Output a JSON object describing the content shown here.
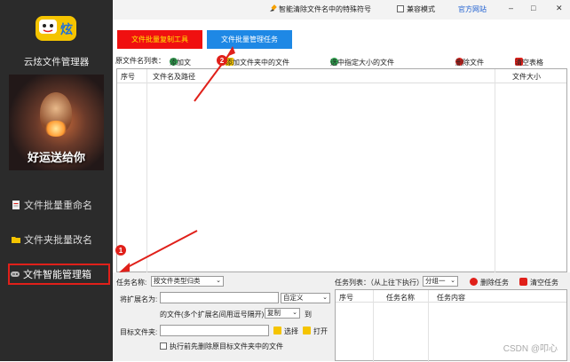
{
  "sidebar": {
    "app_title": "云炫文件管理器",
    "banner_text": "好运送给你",
    "items": [
      {
        "label": "文件批量重命名"
      },
      {
        "label": "文件夹批量改名"
      },
      {
        "label": "文件智能管理箱"
      }
    ]
  },
  "topbar": {
    "clean_special_chars": "智能清除文件名中的特殊符号",
    "compat_mode": "兼容模式",
    "official_site": "官方网站"
  },
  "tabs": {
    "copy_tool": "文件批量复制工具",
    "manage_task": "文件批量管理任务"
  },
  "toolbar": {
    "source_label": "原文件名列表：",
    "add_file": "添加文",
    "add_folder_files": "添加文件夹中的文件",
    "select_by_size": "选中指定大小的文件",
    "delete_file": "删除文件",
    "clear_table": "清空表格"
  },
  "file_table": {
    "columns": [
      "序号",
      "文件名及路径",
      "文件大小"
    ]
  },
  "task_form": {
    "task_name_label": "任务名称:",
    "task_name_value": "按文件类型归类",
    "ext_label": "将扩展名为:",
    "ext_mode": "自定义",
    "ext_hint": "的文件(多个扩展名间用逗号隔开)",
    "action": "复制",
    "to_label": "到",
    "target_label": "目标文件夹:",
    "choose": "选择",
    "open": "打开",
    "pre_delete": "执行前先删除原目标文件夹中的文件"
  },
  "task_list": {
    "label": "任务列表：（从上往下执行）",
    "group": "分组一",
    "delete_task": "删除任务",
    "clear_tasks": "清空任务",
    "columns": [
      "序号",
      "任务名称",
      "任务内容"
    ]
  },
  "annotations": {
    "badge_1": "1",
    "badge_2": "2"
  },
  "watermark": "CSDN @叩心",
  "colors": {
    "accent_red": "#e0201a",
    "tab_red": "#f01010",
    "tab_blue": "#1e88e5",
    "sidebar_bg": "#2b2b2b"
  }
}
